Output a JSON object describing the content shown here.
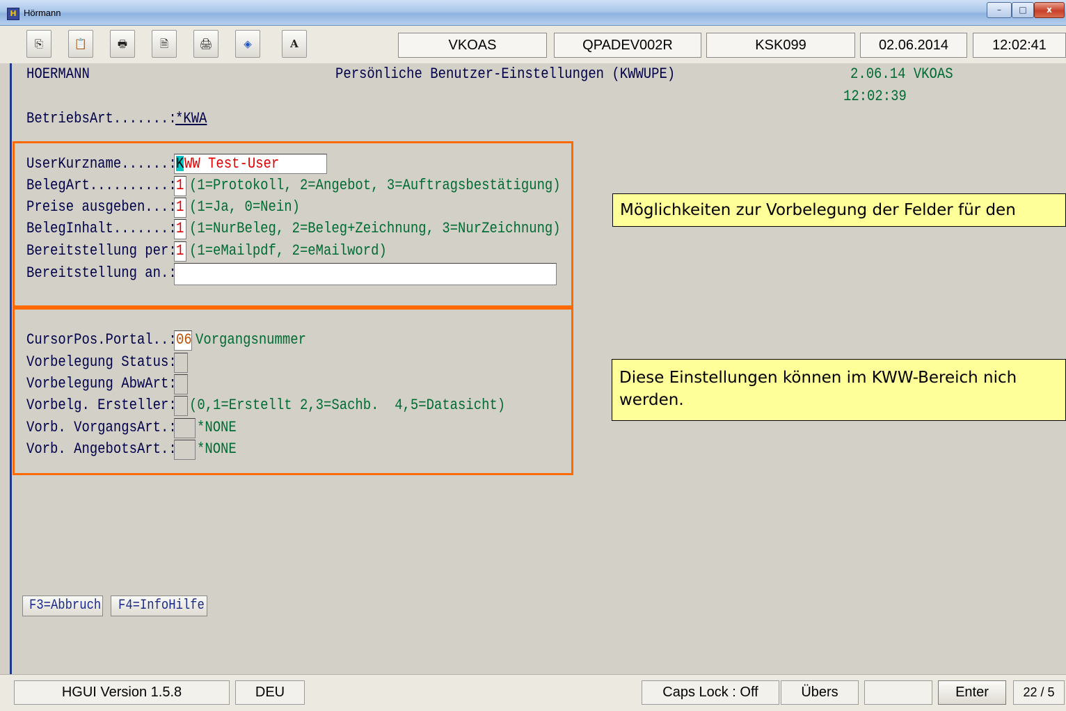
{
  "window": {
    "title": "Hörmann",
    "icon_glyph": "H",
    "controls": [
      "–",
      "□",
      "x"
    ]
  },
  "toolbar": {
    "buttons": [
      {
        "name": "copy-icon",
        "glyph": "⎘"
      },
      {
        "name": "paste-icon",
        "glyph": "📋"
      },
      {
        "name": "print-icon",
        "glyph": "🖶"
      },
      {
        "name": "print-preview-icon",
        "glyph": "🗎"
      },
      {
        "name": "print-setup-icon",
        "glyph": "🖨"
      },
      {
        "name": "diamond-icon",
        "glyph": "◈"
      },
      {
        "name": "font-icon",
        "glyph": "A"
      }
    ],
    "info": [
      "VKOAS",
      "QPADEV002R",
      "KSK099",
      "02.06.2014",
      "12:02:41"
    ]
  },
  "screen": {
    "company": "HOERMANN",
    "heading": "Persönliche Benutzer-Einstellungen (KWWUPE)",
    "date_user": "2.06.14 VKOAS",
    "time": "12:02:39",
    "betriebsart_label": "BetriebsArt.......:",
    "betriebsart_value": "*KWA",
    "rows1": [
      {
        "label": "UserKurzname......:",
        "cursor": "K",
        "value": "WW Test-User",
        "hint": ""
      },
      {
        "label": "BelegArt..........:",
        "value": "1",
        "hint": "(1=Protokoll, 2=Angebot, 3=Auftragsbestätigung)"
      },
      {
        "label": "Preise ausgeben...:",
        "value": "1",
        "hint": "(1=Ja, 0=Nein)"
      },
      {
        "label": "BelegInhalt.......:",
        "value": "1",
        "hint": "(1=NurBeleg, 2=Beleg+Zeichnung, 3=NurZeichnung)"
      },
      {
        "label": "Bereitstellung per:",
        "value": "1",
        "hint": "(1=eMailpdf, 2=eMailword)"
      },
      {
        "label": "Bereitstellung an.:",
        "value": "",
        "hint": ""
      }
    ],
    "rows2": [
      {
        "label": "CursorPos.Portal..:",
        "value": "06",
        "hint": "Vorgangsnummer"
      },
      {
        "label": "Vorbelegung Status:",
        "value": "",
        "hint": ""
      },
      {
        "label": "Vorbelegung AbwArt:",
        "value": "",
        "hint": ""
      },
      {
        "label": "Vorbelg. Ersteller:",
        "value": "",
        "hint": "(0,1=Erstellt 2,3=Sachb.  4,5=Datasicht)"
      },
      {
        "label": "Vorb. VorgangsArt.:",
        "value": "",
        "hint": "*NONE"
      },
      {
        "label": "Vorb. AngebotsArt.:",
        "value": "",
        "hint": "*NONE"
      }
    ],
    "callouts": [
      "Möglichkeiten zur Vorbelegung der Felder für den",
      "Diese Einstellungen können im KWW-Bereich nich",
      "werden."
    ],
    "fkeys": [
      "F3=Abbruch",
      "F4=InfoHilfe"
    ]
  },
  "statusbar": {
    "version": "HGUI Version 1.5.8",
    "language": "DEU",
    "caps_lock": "Caps Lock : Off",
    "mode": "Übers",
    "blank": "",
    "enter": "Enter",
    "position": "22 / 5"
  },
  "colors": {
    "frame": "#ff6a00",
    "label_text": "#00004a",
    "hint_text": "#006b33",
    "field_value": "#e00000",
    "callout_bg": "#ffff99"
  }
}
